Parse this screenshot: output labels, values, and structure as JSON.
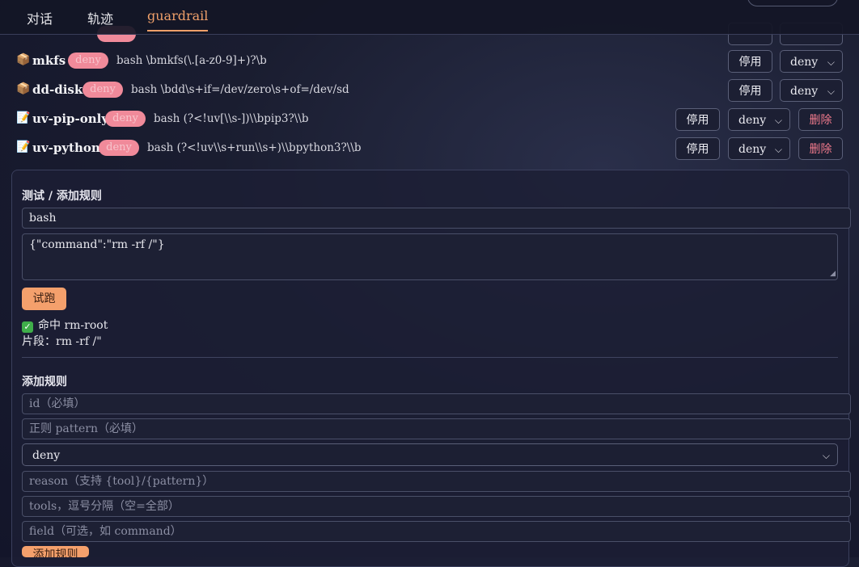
{
  "tabs": [
    {
      "label": "对话",
      "active": false
    },
    {
      "label": "轨迹",
      "active": false
    },
    {
      "label": "guardrail",
      "active": true
    }
  ],
  "rules": [
    {
      "icon": "📦",
      "name": "mkfs",
      "badge": "deny",
      "pattern": "bash \\bmkfs(\\.[a-z0-9]+)?\\b",
      "disable": "停用",
      "action": "deny",
      "delete": ""
    },
    {
      "icon": "📦",
      "name": "dd-disk",
      "badge": "deny",
      "pattern": "bash \\bdd\\s+if=/dev/zero\\s+of=/dev/sd",
      "disable": "停用",
      "action": "deny",
      "delete": ""
    },
    {
      "icon": "📝",
      "name": "uv-pip-only",
      "badge": "deny",
      "pattern": "bash (?<!uv[\\\\s-])\\\\bpip3?\\\\b",
      "disable": "停用",
      "action": "deny",
      "delete": "删除"
    },
    {
      "icon": "📝",
      "name": "uv-python",
      "badge": "deny",
      "pattern": "bash (?<!uv\\\\s+run\\\\s+)\\\\bpython3?\\\\b",
      "disable": "停用",
      "action": "deny",
      "delete": "删除"
    }
  ],
  "test": {
    "title": "测试 / 添加规则",
    "tool_value": "bash",
    "args_value": "{\"command\":\"rm -rf /\"}",
    "run_label": "试跑",
    "result_hit": "命中 rm-root",
    "result_snippet": "片段：rm -rf /\""
  },
  "add": {
    "title": "添加规则",
    "id_placeholder": "id（必填）",
    "pattern_placeholder": "正则 pattern（必填）",
    "action_value": "deny",
    "reason_placeholder": "reason（支持 {tool}/{pattern}）",
    "tools_placeholder": "tools，逗号分隔（空=全部）",
    "field_placeholder": "field（可选，如 command）",
    "submit_label": "添加规则"
  },
  "colors": {
    "accent": "#f0a06a",
    "danger": "#f07a8c",
    "badge": "#f08a9a",
    "button_primary": "#f4a06c"
  }
}
